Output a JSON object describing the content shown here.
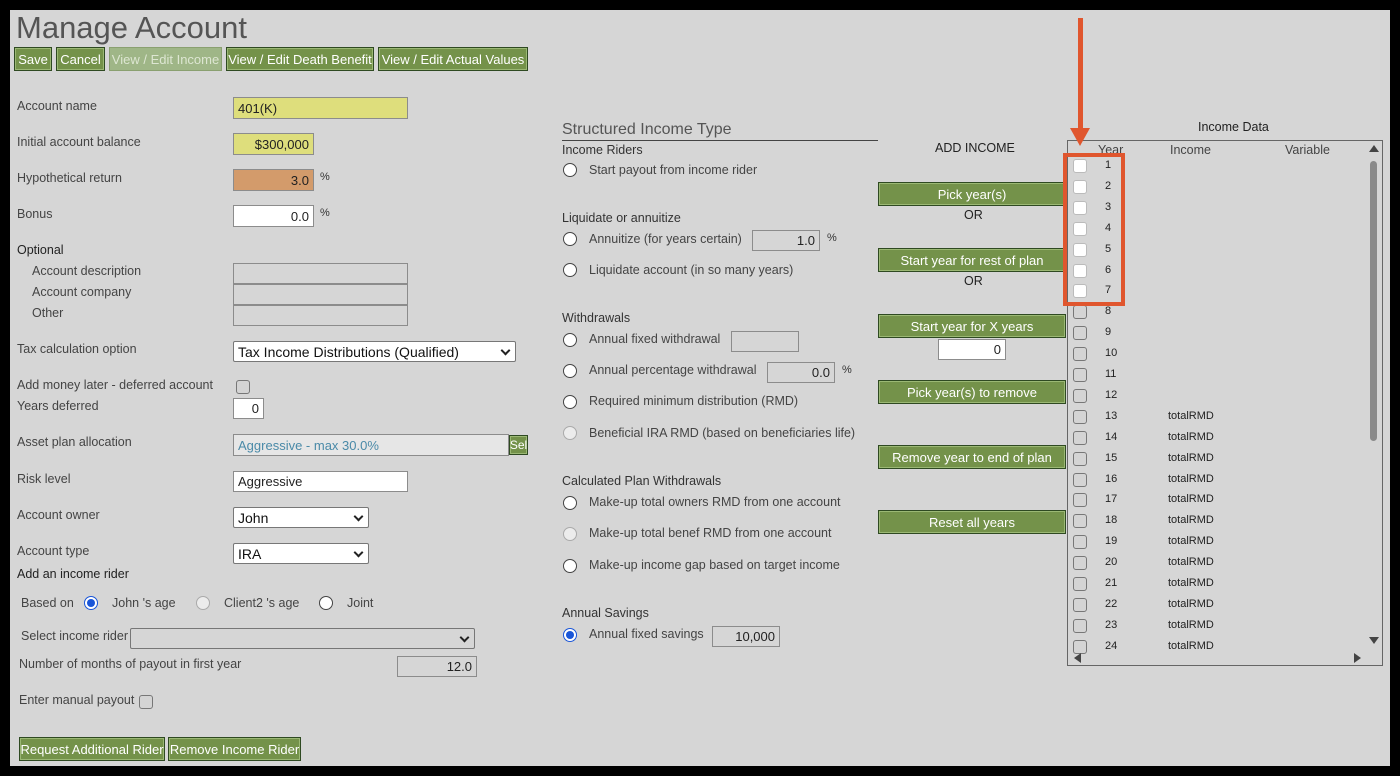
{
  "page_title": "Manage Account",
  "toolbar": {
    "save": "Save",
    "cancel": "Cancel",
    "view_income": "View / Edit Income",
    "view_death": "View / Edit Death Benefit",
    "view_actual": "View / Edit Actual Values"
  },
  "form": {
    "account_name_label": "Account name",
    "account_name": "401(K)",
    "initial_balance_label": "Initial account balance",
    "initial_balance": "$300,000",
    "hyp_return_label": "Hypothetical return",
    "hyp_return": "3.0",
    "bonus_label": "Bonus",
    "bonus": "0.0",
    "pct": "%",
    "optional_label": "Optional",
    "acct_desc_label": "Account description",
    "acct_company_label": "Account company",
    "other_label": "Other",
    "tax_calc_label": "Tax calculation option",
    "tax_calc": "Tax Income Distributions (Qualified)",
    "add_money_label": "Add money later - deferred account",
    "years_deferred_label": "Years deferred",
    "years_deferred": "0",
    "asset_plan_label": "Asset plan allocation",
    "asset_plan": "Aggressive - max 30.0%",
    "sel_btn": "Sel",
    "risk_label": "Risk level",
    "risk": "Aggressive",
    "owner_label": "Account owner",
    "owner": "John",
    "type_label": "Account type",
    "type": "IRA"
  },
  "rider": {
    "title": "Add an income rider",
    "based_on": "Based on",
    "opt_john": "John 's age",
    "opt_client2": "Client2 's age",
    "opt_joint": "Joint",
    "select_label": "Select income rider",
    "months_label": "Number of months of payout in first year",
    "months": "12.0",
    "manual_label": "Enter manual payout",
    "request_btn": "Request Additional Rider",
    "remove_btn": "Remove Income Rider"
  },
  "structured": {
    "title": "Structured Income Type",
    "riders_hdr": "Income Riders",
    "start_payout": "Start payout from income rider",
    "liq_hdr": "Liquidate or annuitize",
    "annuitize": "Annuitize (for years certain)",
    "annuitize_val": "1.0",
    "liquidate": "Liquidate account (in so many years)",
    "withdrawals_hdr": "Withdrawals",
    "fixed_wd": "Annual fixed withdrawal",
    "pct_wd": "Annual percentage withdrawal",
    "pct_wd_val": "0.0",
    "rmd": "Required minimum distribution (RMD)",
    "bene_rmd": "Beneficial IRA RMD (based on beneficiaries life)",
    "calc_hdr": "Calculated Plan Withdrawals",
    "makeup_owner": "Make-up total owners RMD from one account",
    "makeup_benef": "Make-up total benef RMD from one account",
    "makeup_gap": "Make-up income gap based on target income",
    "savings_hdr": "Annual Savings",
    "fixed_savings": "Annual fixed savings",
    "fixed_savings_val": "10,000"
  },
  "add_income": {
    "title": "ADD INCOME",
    "pick_years": "Pick year(s)",
    "or": "OR",
    "start_rest": "Start year for rest of plan",
    "start_x": "Start year for X years",
    "x_years_val": "0",
    "pick_remove": "Pick year(s) to remove",
    "remove_end": "Remove year to end of plan",
    "reset": "Reset all years"
  },
  "income_data": {
    "title": "Income Data",
    "col_year": "Year",
    "col_income": "Income",
    "col_variable": "Variable",
    "rows": [
      {
        "year": "1",
        "income": ""
      },
      {
        "year": "2",
        "income": ""
      },
      {
        "year": "3",
        "income": ""
      },
      {
        "year": "4",
        "income": ""
      },
      {
        "year": "5",
        "income": ""
      },
      {
        "year": "6",
        "income": ""
      },
      {
        "year": "7",
        "income": ""
      },
      {
        "year": "8",
        "income": ""
      },
      {
        "year": "9",
        "income": ""
      },
      {
        "year": "10",
        "income": ""
      },
      {
        "year": "11",
        "income": ""
      },
      {
        "year": "12",
        "income": ""
      },
      {
        "year": "13",
        "income": "totalRMD"
      },
      {
        "year": "14",
        "income": "totalRMD"
      },
      {
        "year": "15",
        "income": "totalRMD"
      },
      {
        "year": "16",
        "income": "totalRMD"
      },
      {
        "year": "17",
        "income": "totalRMD"
      },
      {
        "year": "18",
        "income": "totalRMD"
      },
      {
        "year": "19",
        "income": "totalRMD"
      },
      {
        "year": "20",
        "income": "totalRMD"
      },
      {
        "year": "21",
        "income": "totalRMD"
      },
      {
        "year": "22",
        "income": "totalRMD"
      },
      {
        "year": "23",
        "income": "totalRMD"
      },
      {
        "year": "24",
        "income": "totalRMD"
      }
    ]
  },
  "colors": {
    "button_green": "#74924a",
    "callout_orange": "#e0562e"
  }
}
